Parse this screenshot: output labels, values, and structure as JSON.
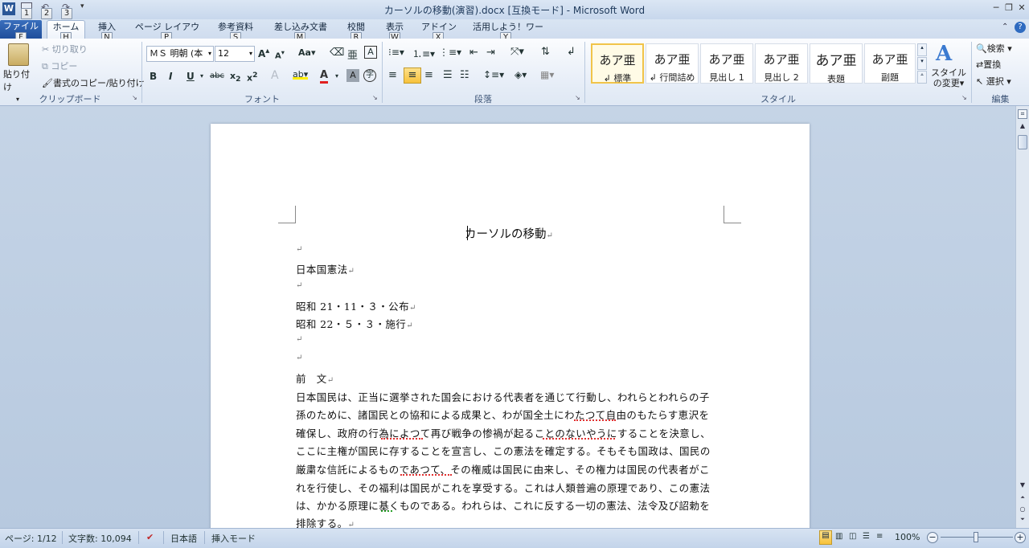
{
  "window": {
    "title": "カーソルの移動(演習).docx [互換モード] - Microsoft Word"
  },
  "quick_access": {
    "keys": [
      "1",
      "2",
      "3"
    ]
  },
  "tabs": [
    {
      "label": "ファイル",
      "key": "F"
    },
    {
      "label": "ホーム",
      "key": "H"
    },
    {
      "label": "挿入",
      "key": "N"
    },
    {
      "label": "ページ レイアウト",
      "key": "P"
    },
    {
      "label": "参考資料",
      "key": "S"
    },
    {
      "label": "差し込み文書",
      "key": "M"
    },
    {
      "label": "校閲",
      "key": "R"
    },
    {
      "label": "表示",
      "key": "W"
    },
    {
      "label": "アドイン",
      "key": "X"
    },
    {
      "label": "活用しよう！ワード",
      "key": "Y"
    }
  ],
  "clipboard": {
    "paste": "貼り付け",
    "cut": "切り取り",
    "copy": "コピー",
    "format_painter": "書式のコピー/貼り付け",
    "group": "クリップボード"
  },
  "font": {
    "name": "ＭＳ 明朝 (本",
    "size": "12",
    "group": "フォント",
    "case": "Aa"
  },
  "paragraph": {
    "group": "段落"
  },
  "styles": {
    "items": [
      {
        "sample": "あア亜",
        "name": "↲ 標準"
      },
      {
        "sample": "あア亜",
        "name": "↲ 行間詰め"
      },
      {
        "sample": "あア亜",
        "name": "見出し 1"
      },
      {
        "sample": "あア亜",
        "name": "見出し 2"
      },
      {
        "sample": "あア亜",
        "name": "表題"
      },
      {
        "sample": "あア亜",
        "name": "副題"
      }
    ],
    "change": "スタイルの変更",
    "group": "スタイル"
  },
  "editing": {
    "find": "検索",
    "replace": "置換",
    "select": "選択",
    "group": "編集"
  },
  "document": {
    "title": "カーソルの移動",
    "lines": [
      "日本国憲法",
      "昭和 21・11・３・公布",
      "昭和 22・５・３・施行",
      "前　文"
    ],
    "body": [
      "日本国民は、正当に選挙された国会における代表者を通じて行動し、われらとわれらの子",
      "孫のために、諸国民との協和による成果と、わが国全土にわたつて自由のもたらす恵沢を",
      "確保し、政府の行為によつて再び戦争の惨禍が起ることのないやうにすることを決意し、",
      "ここに主権が国民に存することを宣言し、この憲法を確定する。そもそも国政は、国民の",
      "厳粛な信託によるものであつて、その権威は国民に由来し、その権力は国民の代表者がこ",
      "れを行使し、その福利は国民がこれを享受する。これは人類普遍の原理であり、この憲法",
      "は、かかる原理に基くものである。われらは、これに反する一切の憲法、法令及び詔勅を",
      "排除する。"
    ],
    "mark": "↵"
  },
  "status": {
    "page": "ページ: 1/12",
    "words": "文字数: 10,094",
    "language": "日本語",
    "mode": "挿入モード",
    "zoom": "100%"
  }
}
